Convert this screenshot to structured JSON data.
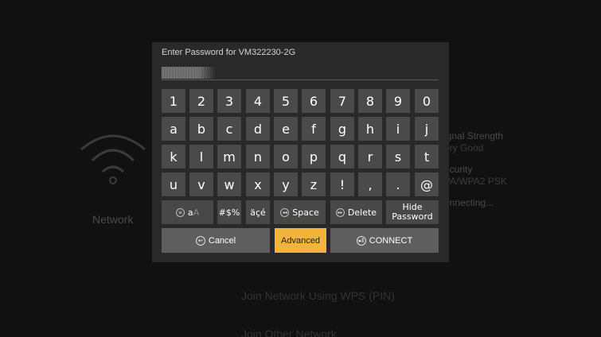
{
  "background": {
    "network_label": "Network",
    "info": [
      {
        "label": "ignal Strength",
        "value": "ery Good"
      },
      {
        "label": "ecurity",
        "value": "PA/WPA2 PSK"
      },
      {
        "label": "onnecting...",
        "value": ""
      }
    ],
    "menu": [
      "Join Network Using WPS (PIN)",
      "Join Other Network"
    ]
  },
  "dialog": {
    "title": "Enter Password for VM322230-2G"
  },
  "keyboard": {
    "rows": [
      [
        "1",
        "2",
        "3",
        "4",
        "5",
        "6",
        "7",
        "8",
        "9",
        "0"
      ],
      [
        "a",
        "b",
        "c",
        "d",
        "e",
        "f",
        "g",
        "h",
        "i",
        "j"
      ],
      [
        "k",
        "l",
        "m",
        "n",
        "o",
        "p",
        "q",
        "r",
        "s",
        "t"
      ],
      [
        "u",
        "v",
        "w",
        "x",
        "y",
        "z",
        "!",
        ",",
        ".",
        "@"
      ]
    ],
    "function_row": {
      "case_main": "a",
      "case_alt": "A",
      "symbols": "#$%",
      "accents": "äçé",
      "space": "Space",
      "delete": "Delete",
      "hide_line1": "Hide",
      "hide_line2": "Password"
    }
  },
  "actions": {
    "cancel": "Cancel",
    "advanced": "Advanced",
    "connect": "CONNECT"
  },
  "colors": {
    "dialog_bg": "#292929",
    "key_bg": "#4a4a4a",
    "action_bg": "#5e5e5e",
    "accent": "#f2b43a"
  }
}
